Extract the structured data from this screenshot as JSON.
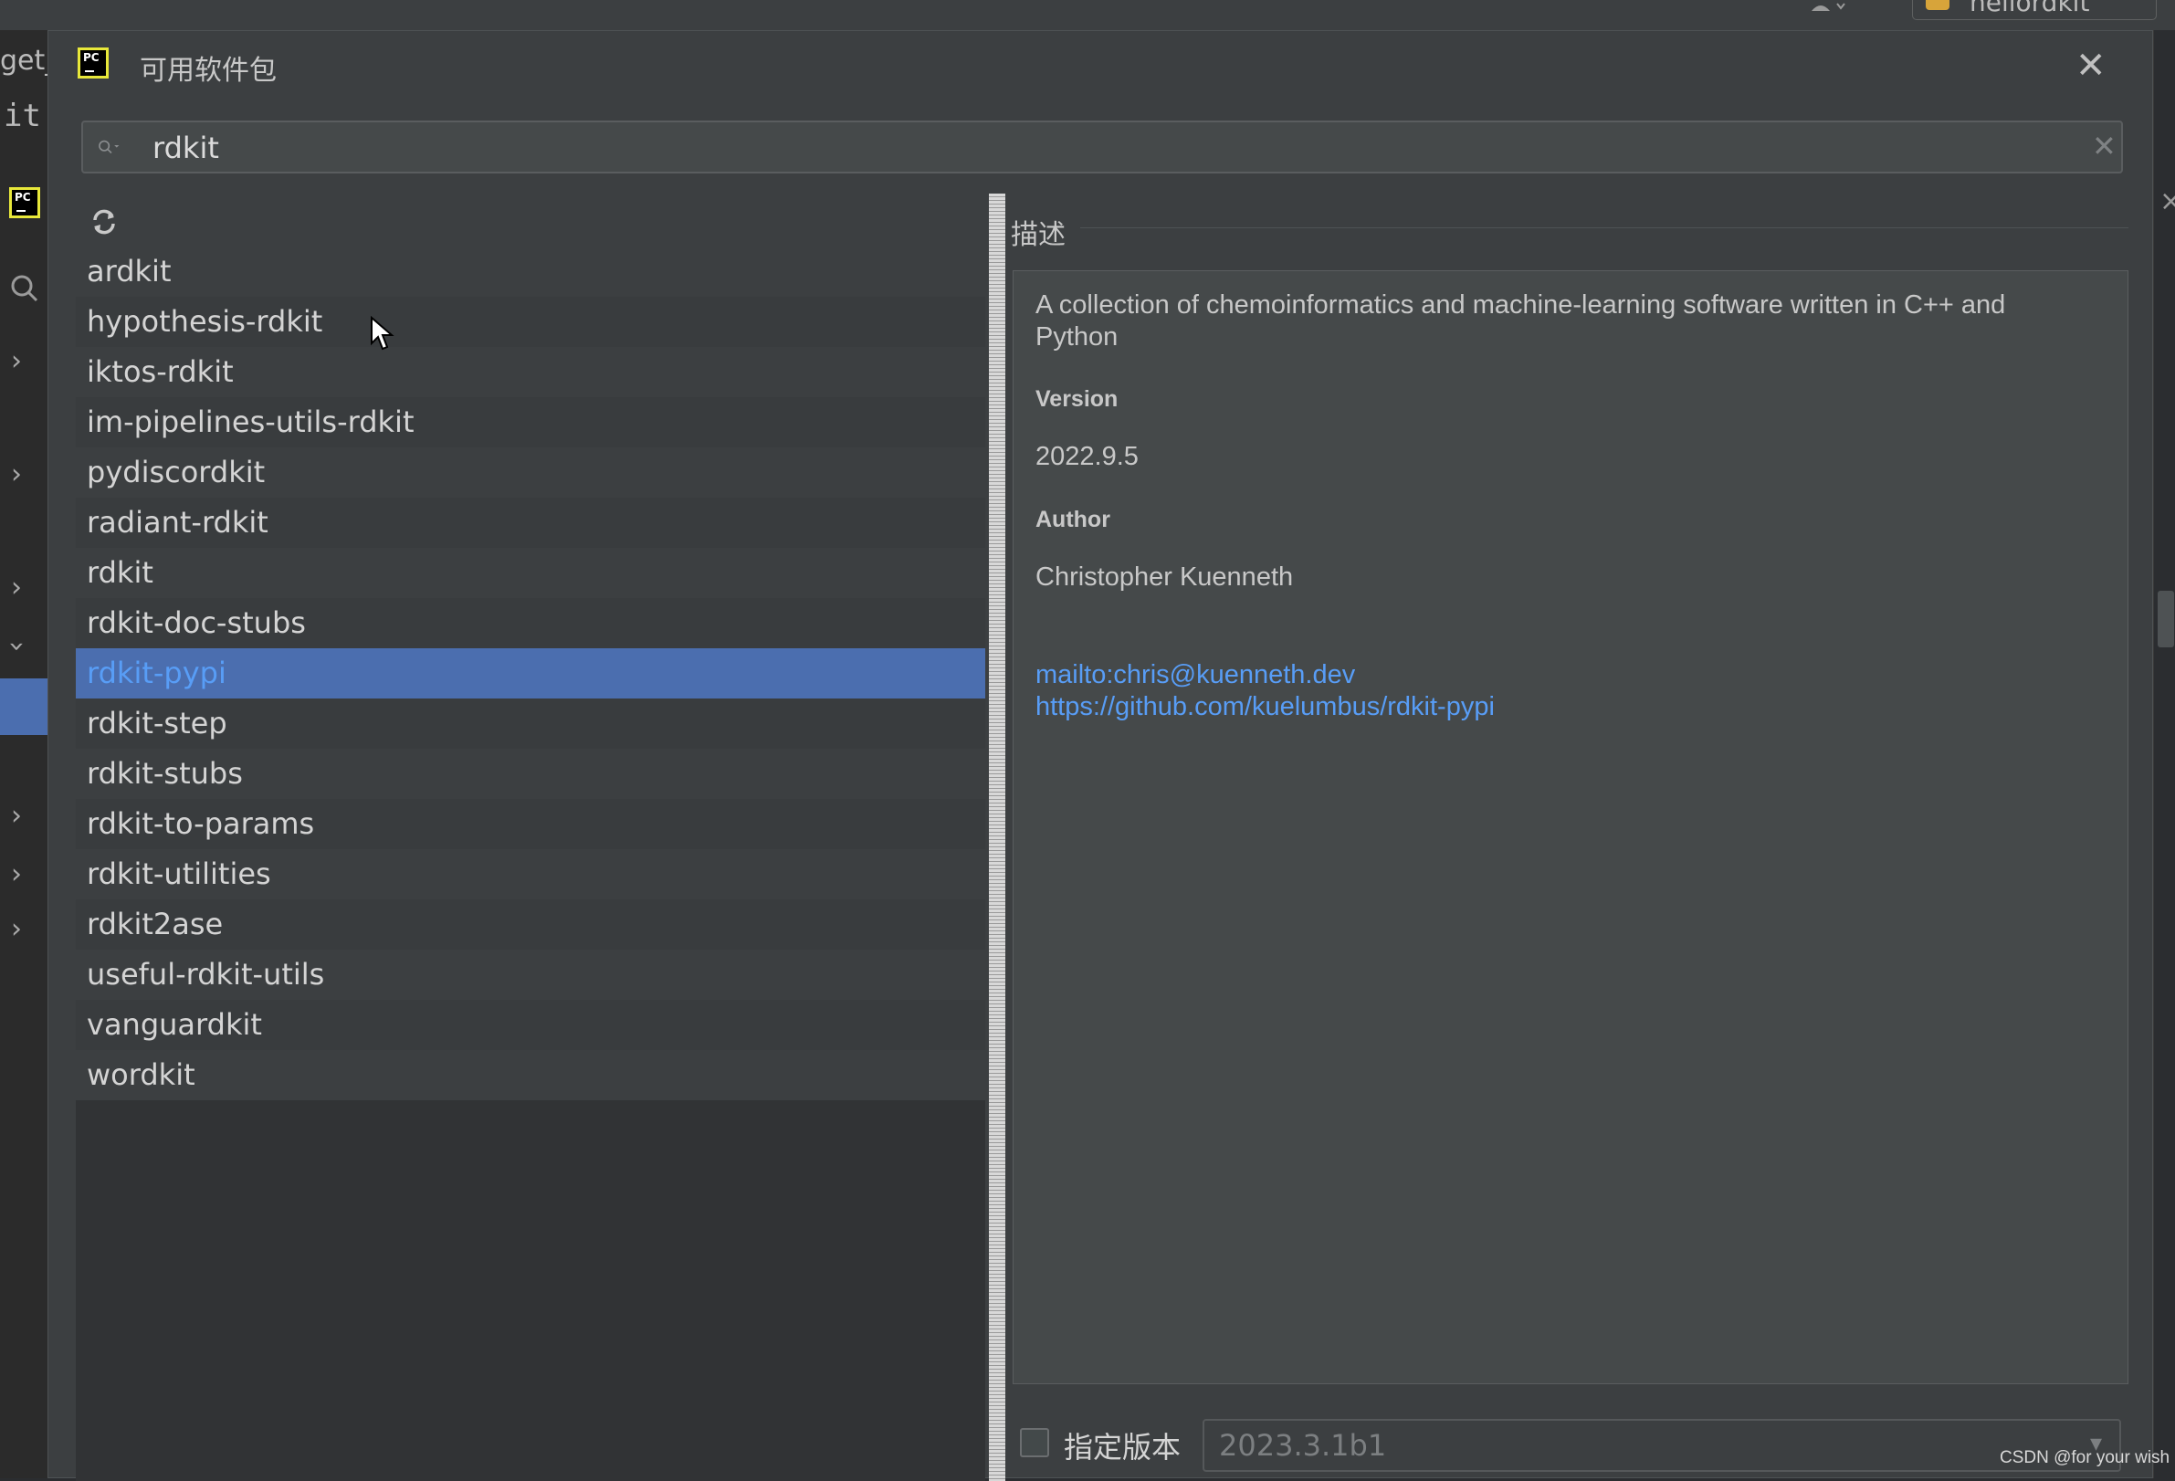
{
  "background": {
    "project_name": "hellordkit",
    "left_text_1": "get_",
    "left_text_2": "it"
  },
  "dialog": {
    "title": "可用软件包",
    "search": {
      "value": "rdkit"
    },
    "packages": [
      "ardkit",
      "hypothesis-rdkit",
      "iktos-rdkit",
      "im-pipelines-utils-rdkit",
      "pydiscordkit",
      "radiant-rdkit",
      "rdkit",
      "rdkit-doc-stubs",
      "rdkit-pypi",
      "rdkit-step",
      "rdkit-stubs",
      "rdkit-to-params",
      "rdkit-utilities",
      "rdkit2ase",
      "useful-rdkit-utils",
      "vanguardkit",
      "wordkit"
    ],
    "selected_package": "rdkit-pypi",
    "description": {
      "header": "描述",
      "summary": "A collection of chemoinformatics and machine-learning software written in C++ and Python",
      "version_label": "Version",
      "version": "2022.9.5",
      "author_label": "Author",
      "author": "Christopher Kuenneth",
      "links": [
        "mailto:chris@kuenneth.dev",
        "https://github.com/kuelumbus/rdkit-pypi"
      ]
    },
    "specify_version": {
      "label": "指定版本",
      "checked": false,
      "value": "2023.3.1b1"
    }
  },
  "watermark": "CSDN @for your wish",
  "colors": {
    "selection": "#4b6eaf",
    "link": "#589df6",
    "dialog_bg": "#3c3f41"
  }
}
